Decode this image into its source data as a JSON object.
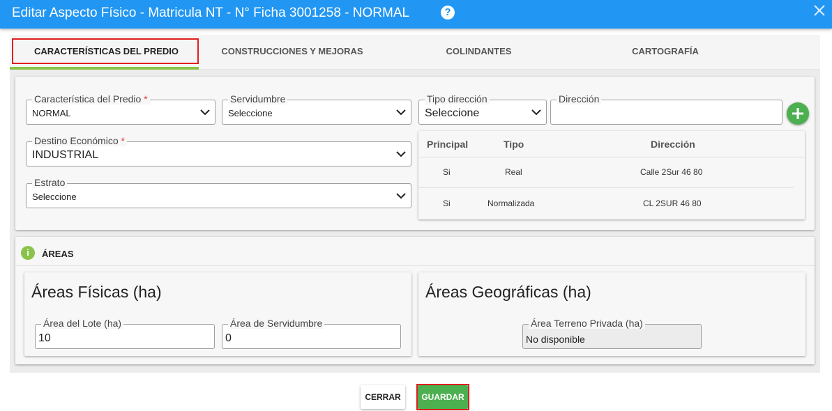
{
  "window": {
    "title": "Editar Aspecto Físico - Matricula NT - N° Ficha 3001258 - NORMAL",
    "help_icon": "question-circle-icon",
    "close_icon": "close-icon",
    "header_color": "#2196f3"
  },
  "tabs": [
    {
      "label": "CARACTERÍSTICAS DEL PREDIO",
      "active": true
    },
    {
      "label": "CONSTRUCCIONES Y MEJORAS",
      "active": false
    },
    {
      "label": "COLINDANTES",
      "active": false
    },
    {
      "label": "CARTOGRAFÍA",
      "active": false
    }
  ],
  "form": {
    "caracteristica": {
      "label": "Característica del Predio",
      "required_mark": "*",
      "value": "NORMAL"
    },
    "servidumbre": {
      "label": "Servidumbre",
      "value": "Seleccione"
    },
    "destino": {
      "label": "Destino Económico",
      "required_mark": "*",
      "value": "INDUSTRIAL"
    },
    "estrato": {
      "label": "Estrato",
      "value": "Seleccione"
    },
    "tipo_direccion": {
      "label": "Tipo dirección",
      "value": "Seleccione"
    },
    "direccion": {
      "label": "Dirección",
      "value": ""
    },
    "add_icon": "plus-icon"
  },
  "address_table": {
    "headers": [
      "Principal",
      "Tipo",
      "Dirección"
    ],
    "rows": [
      {
        "principal": "Si",
        "tipo": "Real",
        "direccion": "Calle 2Sur 46 80"
      },
      {
        "principal": "Si",
        "tipo": "Normalizada",
        "direccion": "CL 2SUR 46 80"
      }
    ]
  },
  "areas": {
    "section_title": "ÁREAS",
    "info_icon": "info-icon",
    "fisicas": {
      "title": "Áreas Físicas (ha)",
      "lote": {
        "label": "Área del Lote (ha)",
        "value": "10"
      },
      "servidumbre": {
        "label": "Área de Servidumbre",
        "value": "0"
      }
    },
    "geograficas": {
      "title": "Áreas Geográficas (ha)",
      "terreno_privada": {
        "label": "Área Terreno Privada (ha)",
        "value": "No disponible"
      }
    }
  },
  "footer": {
    "close_label": "CERRAR",
    "save_label": "GUARDAR",
    "accent_green": "#4caf50",
    "highlight_red": "#e01e1e"
  }
}
